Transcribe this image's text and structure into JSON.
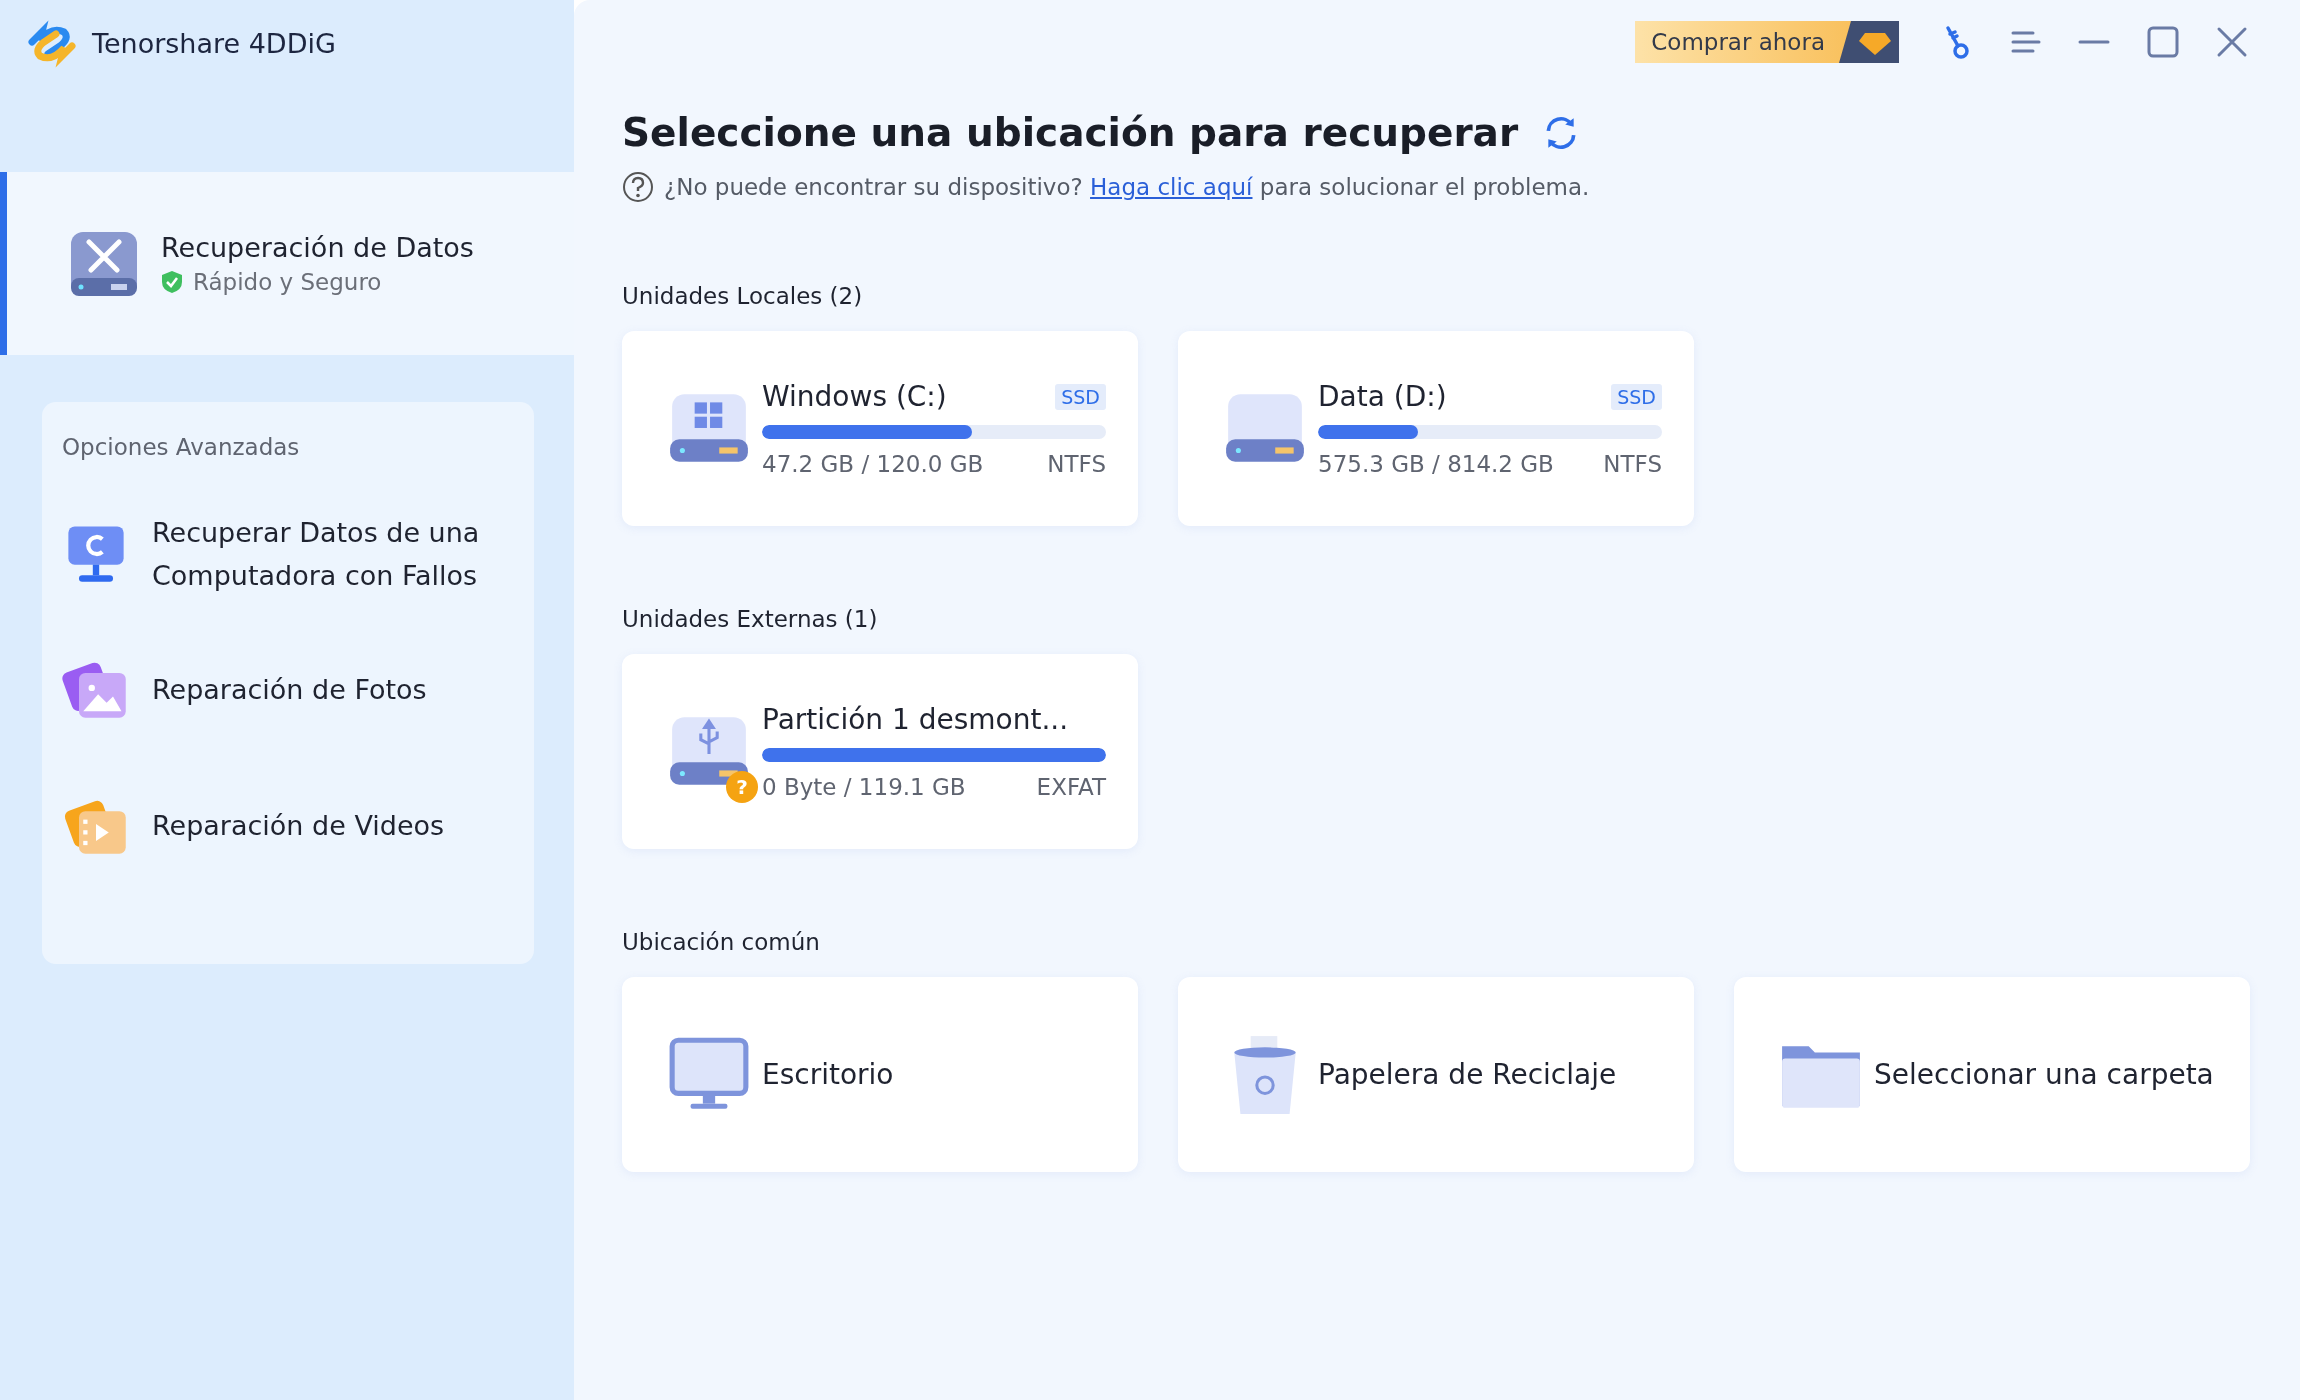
{
  "app": {
    "title": "Tenorshare 4DDiG"
  },
  "toolbar": {
    "buy_button": "Comprar ahora"
  },
  "sidebar": {
    "main_item": {
      "title": "Recuperación de Datos",
      "subtitle": "Rápido y Seguro",
      "selected": true
    },
    "advanced": {
      "title": "Opciones Avanzadas",
      "items": [
        {
          "label": "Recuperar Datos de una Computadora con Fallos",
          "kind": "crash",
          "selected": false
        },
        {
          "label": "Reparación de Fotos",
          "kind": "photo",
          "selected": false
        },
        {
          "label": "Reparación de Videos",
          "kind": "video",
          "selected": false
        }
      ]
    }
  },
  "main": {
    "title": "Seleccione una ubicación para recuperar",
    "help": {
      "before": "¿No puede encontrar su dispositivo?",
      "link": "Haga clic aquí",
      "after": "para solucionar el problema."
    },
    "sections": [
      {
        "title": "Unidades Locales (2)",
        "drives": [
          {
            "name": "Windows (C:)",
            "kind": "windows",
            "badge": "SSD",
            "usage": "47.2 GB / 120.0 GB",
            "filesystem": "NTFS",
            "level": 0.61
          },
          {
            "name": "Data (D:)",
            "kind": "plain",
            "badge": "SSD",
            "usage": "575.3 GB / 814.2 GB",
            "filesystem": "NTFS",
            "level": 0.29
          }
        ]
      },
      {
        "title": "Unidades Externas (1)",
        "drives": [
          {
            "name": "Partición 1 desmont...",
            "kind": "usb",
            "warning": "?",
            "usage": "0 Byte / 119.1 GB",
            "filesystem": "EXFAT",
            "level": 1
          }
        ]
      }
    ],
    "common": {
      "title": "Ubicación común",
      "items": [
        {
          "label": "Escritorio",
          "kind": "desktop"
        },
        {
          "label": "Papelera de Reciclaje",
          "kind": "recycle"
        },
        {
          "label": "Seleccionar una carpeta",
          "kind": "folder"
        }
      ]
    }
  }
}
